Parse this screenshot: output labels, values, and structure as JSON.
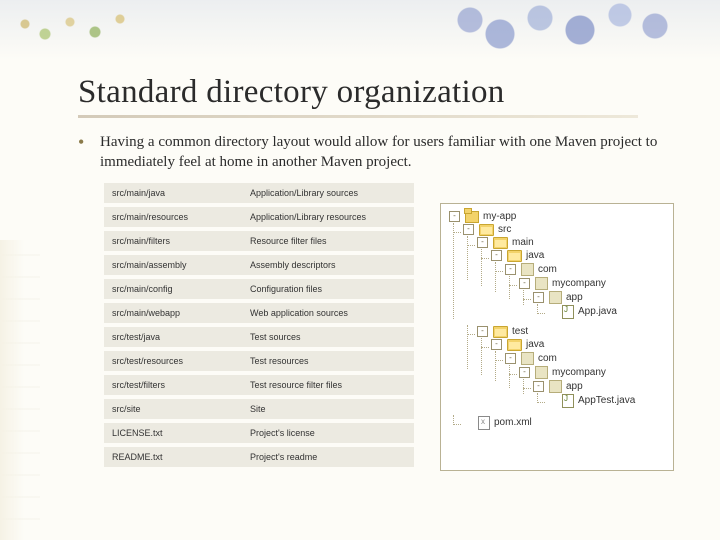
{
  "title": "Standard directory organization",
  "paragraph": "Having a common directory layout would allow for users familiar with one Maven project to immediately feel at home in another Maven project.",
  "table": {
    "rows": [
      {
        "path": "src/main/java",
        "desc": "Application/Library sources"
      },
      {
        "path": "src/main/resources",
        "desc": "Application/Library resources"
      },
      {
        "path": "src/main/filters",
        "desc": "Resource filter files"
      },
      {
        "path": "src/main/assembly",
        "desc": "Assembly descriptors"
      },
      {
        "path": "src/main/config",
        "desc": "Configuration files"
      },
      {
        "path": "src/main/webapp",
        "desc": "Web application sources"
      },
      {
        "path": "src/test/java",
        "desc": "Test sources"
      },
      {
        "path": "src/test/resources",
        "desc": "Test resources"
      },
      {
        "path": "src/test/filters",
        "desc": "Test resource filter files"
      },
      {
        "path": "src/site",
        "desc": "Site"
      },
      {
        "path": "LICENSE.txt",
        "desc": "Project's license"
      },
      {
        "path": "README.txt",
        "desc": "Project's readme"
      }
    ]
  },
  "tree": {
    "root": "my-app",
    "src": "src",
    "main": "main",
    "test": "test",
    "java": "java",
    "com": "com",
    "mycompany": "mycompany",
    "app": "app",
    "app_java": "App.java",
    "apptest_java": "AppTest.java",
    "pom": "pom.xml"
  }
}
